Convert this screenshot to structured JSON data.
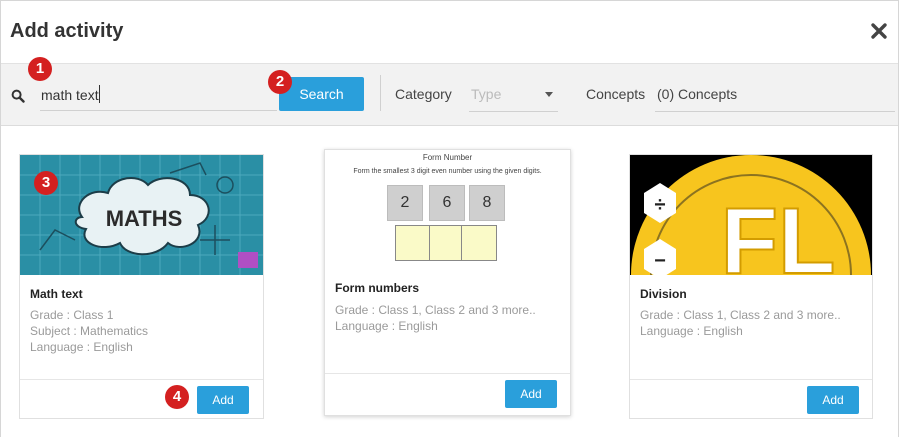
{
  "dialog": {
    "title": "Add activity",
    "close_icon": "close-icon"
  },
  "toolbar": {
    "search_value": "math text",
    "search_button": "Search",
    "category_label": "Category",
    "type_placeholder": "Type",
    "concepts_label": "Concepts",
    "concepts_value": "(0) Concepts"
  },
  "markers": [
    "1",
    "2",
    "3",
    "4"
  ],
  "cards": [
    {
      "title": "Math text",
      "thumb_text": "MATHS",
      "grade": "Grade : Class 1",
      "subject": "Subject : Mathematics",
      "language": "Language : English",
      "add_label": "Add"
    },
    {
      "title": "Form numbers",
      "thumb_heading": "Form Number",
      "thumb_instruction": "Form the smallest 3 digit even number using the given digits.",
      "digits": [
        "2",
        "6",
        "8"
      ],
      "grade": "Grade : Class 1, Class 2 and 3 more..",
      "language": "Language : English",
      "add_label": "Add"
    },
    {
      "title": "Division",
      "thumb_text": "FL",
      "grade": "Grade : Class 1, Class 2 and 3 more..",
      "language": "Language : English",
      "add_label": "Add"
    }
  ],
  "colors": {
    "accent": "#2a9fdb",
    "marker": "#d42020",
    "toolbar_bg": "#f2f2f2"
  }
}
